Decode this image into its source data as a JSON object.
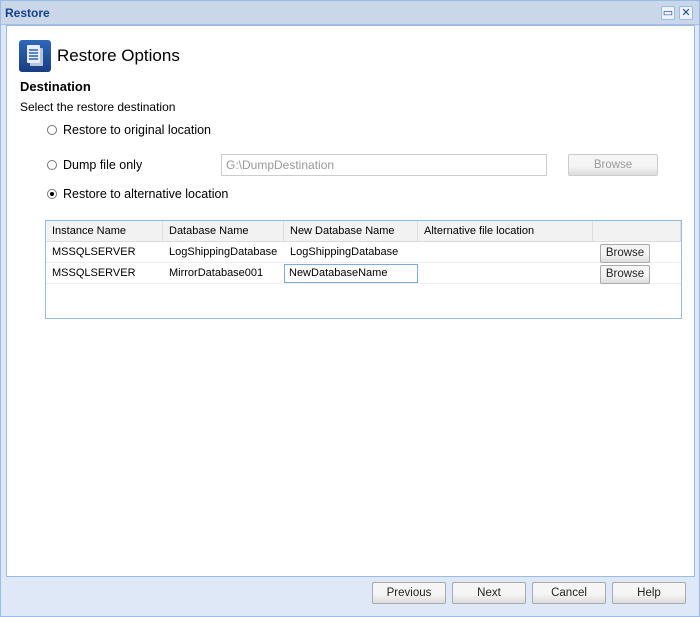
{
  "window": {
    "title": "Restore",
    "maximize_icon": "maximize-icon",
    "close_icon": "close-icon"
  },
  "header": {
    "title": "Restore Options",
    "icon": "document-icon"
  },
  "section": {
    "title": "Destination",
    "subtitle": "Select the restore destination"
  },
  "options": [
    {
      "label": "Restore to original location",
      "selected": false
    },
    {
      "label": "Dump file only",
      "selected": false
    },
    {
      "label": "Restore to alternative location",
      "selected": true
    }
  ],
  "dump": {
    "value": "G:\\DumpDestination",
    "browse_label": "Browse"
  },
  "grid": {
    "columns": [
      "Instance Name",
      "Database Name",
      "New Database Name",
      "Alternative file location",
      ""
    ],
    "rows": [
      {
        "instance": "MSSQLSERVER",
        "database": "LogShippingDatabase",
        "new_name": "LogShippingDatabase",
        "location": "",
        "browse": "Browse"
      },
      {
        "instance": "MSSQLSERVER",
        "database": "MirrorDatabase001",
        "new_name": "NewDatabaseName",
        "location": "",
        "browse": "Browse"
      }
    ]
  },
  "footer": {
    "previous": "Previous",
    "next": "Next",
    "cancel": "Cancel",
    "help": "Help"
  }
}
